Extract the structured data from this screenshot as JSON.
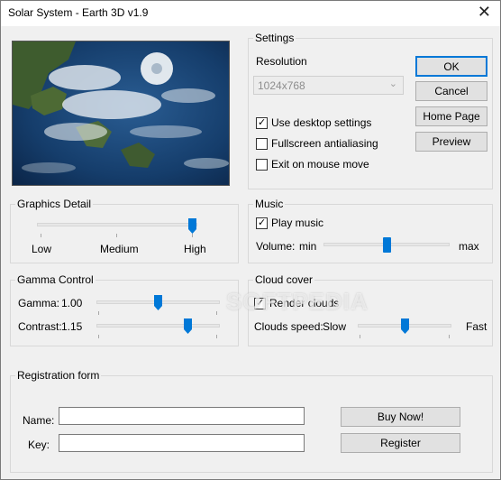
{
  "window": {
    "title": "Solar System - Earth 3D v1.9",
    "close_glyph": "✕"
  },
  "settings": {
    "legend": "Settings",
    "resolution_label": "Resolution",
    "resolution_value": "1024x768",
    "use_desktop": {
      "label": "Use desktop settings",
      "checked": true
    },
    "fullscreen_aa": {
      "label": "Fullscreen antialiasing",
      "checked": false
    },
    "exit_mouse": {
      "label": "Exit on mouse move",
      "checked": false
    }
  },
  "buttons": {
    "ok": "OK",
    "cancel": "Cancel",
    "home_page": "Home Page",
    "preview": "Preview",
    "buy_now": "Buy Now!",
    "register": "Register"
  },
  "graphics": {
    "legend": "Graphics Detail",
    "low": "Low",
    "medium": "Medium",
    "high": "High",
    "level": 1.0
  },
  "music": {
    "legend": "Music",
    "play": {
      "label": "Play music",
      "checked": true
    },
    "volume_label": "Volume:",
    "min": "min",
    "max": "max",
    "volume": 0.5
  },
  "gamma": {
    "legend": "Gamma Control",
    "gamma_label": "Gamma:",
    "gamma_value": "1.00",
    "gamma_level": 0.5,
    "contrast_label": "Contrast:",
    "contrast_value": "1.15",
    "contrast_level": 0.75
  },
  "clouds": {
    "legend": "Cloud cover",
    "render": {
      "label": "Render clouds",
      "checked": true
    },
    "speed_label": "Clouds speed:",
    "slow": "Slow",
    "fast": "Fast",
    "speed": 0.5
  },
  "registration": {
    "legend": "Registration form",
    "name_label": "Name:",
    "key_label": "Key:",
    "name_value": "",
    "key_value": ""
  },
  "watermark": "SOFTPEDIA",
  "colors": {
    "accent": "#0078d7",
    "window_bg": "#f0f0f0",
    "button_bg": "#e1e1e1"
  }
}
